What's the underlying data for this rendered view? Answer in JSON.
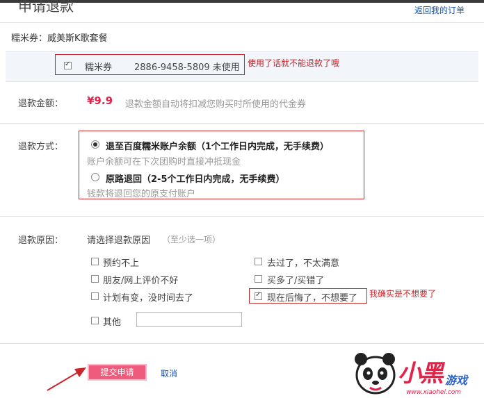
{
  "header": {
    "title": "申请退款",
    "back_link": "返回我的订单"
  },
  "product": {
    "text": "糯米券：威美斯K歌套餐"
  },
  "coupon": {
    "label": "糯米券",
    "code": "2886-9458-5809 未使用",
    "checked": true,
    "note": "使用了话就不能退款了哦"
  },
  "refund_amount": {
    "label": "退款金额：",
    "value": "¥9.9",
    "desc": "退款金额自动将扣减您购买时所使用的代金券"
  },
  "refund_method": {
    "label": "退款方式：",
    "options": [
      {
        "title": "退至百度糯米账户余额（1个工作日内完成，无手续费）",
        "desc": "账户余额可在下次团购时直接冲抵现金",
        "selected": true
      },
      {
        "title": "原路退回（2-5个工作日内完成，无手续费）",
        "desc": "钱款将退回您的原支付账户",
        "selected": false
      }
    ]
  },
  "refund_reason": {
    "label": "退款原因：",
    "prompt": "请选择退款原因",
    "hint": "（至少选一项）",
    "left": [
      {
        "text": "预约不上",
        "checked": false
      },
      {
        "text": "朋友/网上评价不好",
        "checked": false
      },
      {
        "text": "计划有变，没时间去了",
        "checked": false
      },
      {
        "text": "其他",
        "checked": false
      }
    ],
    "right": [
      {
        "text": "去过了，不太满意",
        "checked": false
      },
      {
        "text": "买多了/买错了",
        "checked": false
      },
      {
        "text": "现在后悔了，不想要了",
        "checked": true
      }
    ],
    "note": "我确实是不想要了",
    "other_value": ""
  },
  "actions": {
    "submit": "提交申请",
    "cancel": "取消"
  },
  "watermark": {
    "brand": "小黑",
    "sub": "游戏",
    "url": "www.xiaohei.com"
  },
  "colors": {
    "accent": "#e5214a",
    "link": "#1a55a8",
    "annotation": "#c9252b"
  }
}
